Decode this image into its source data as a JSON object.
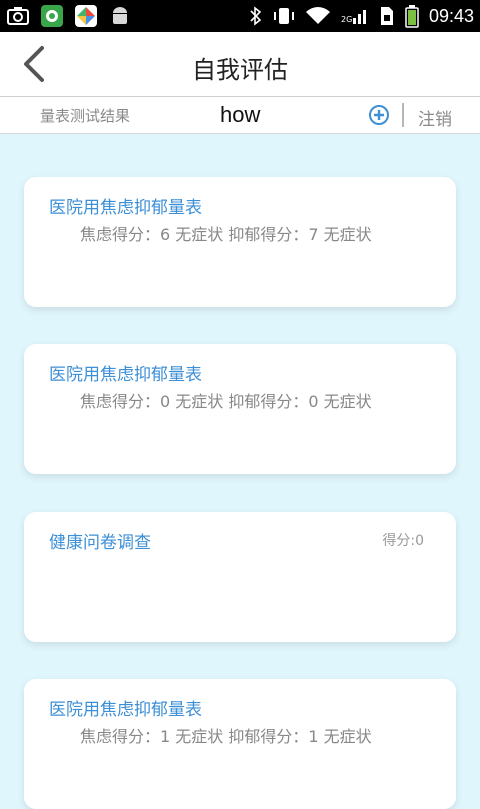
{
  "status_bar": {
    "time": "09:43",
    "icons": [
      "camera-icon",
      "green-app-icon",
      "colorful-app-icon",
      "android-icon",
      "bluetooth-icon",
      "vibrate-icon",
      "wifi-icon",
      "network-2g-icon",
      "sim-icon",
      "battery-icon"
    ]
  },
  "header": {
    "title": "自我评估",
    "back_icon": "back-arrow-icon"
  },
  "subheader": {
    "label": "量表测试结果",
    "username": "how",
    "add_icon": "plus-circle-icon",
    "logout_label": "注销"
  },
  "cards": [
    {
      "title": "医院用焦虑抑郁量表",
      "score_text": "焦虑得分：6 无症状 抑郁得分：7 无症状",
      "right_text": ""
    },
    {
      "title": "医院用焦虑抑郁量表",
      "score_text": "焦虑得分：0 无症状 抑郁得分：0 无症状",
      "right_text": ""
    },
    {
      "title": "健康问卷调查",
      "score_text": "",
      "right_text": "得分:0"
    },
    {
      "title": "医院用焦虑抑郁量表",
      "score_text": "焦虑得分：1 无症状 抑郁得分：1 无症状",
      "right_text": ""
    }
  ],
  "colors": {
    "background": "#dff6fc",
    "accent": "#3d8fd6",
    "status_bar": "#000000"
  }
}
